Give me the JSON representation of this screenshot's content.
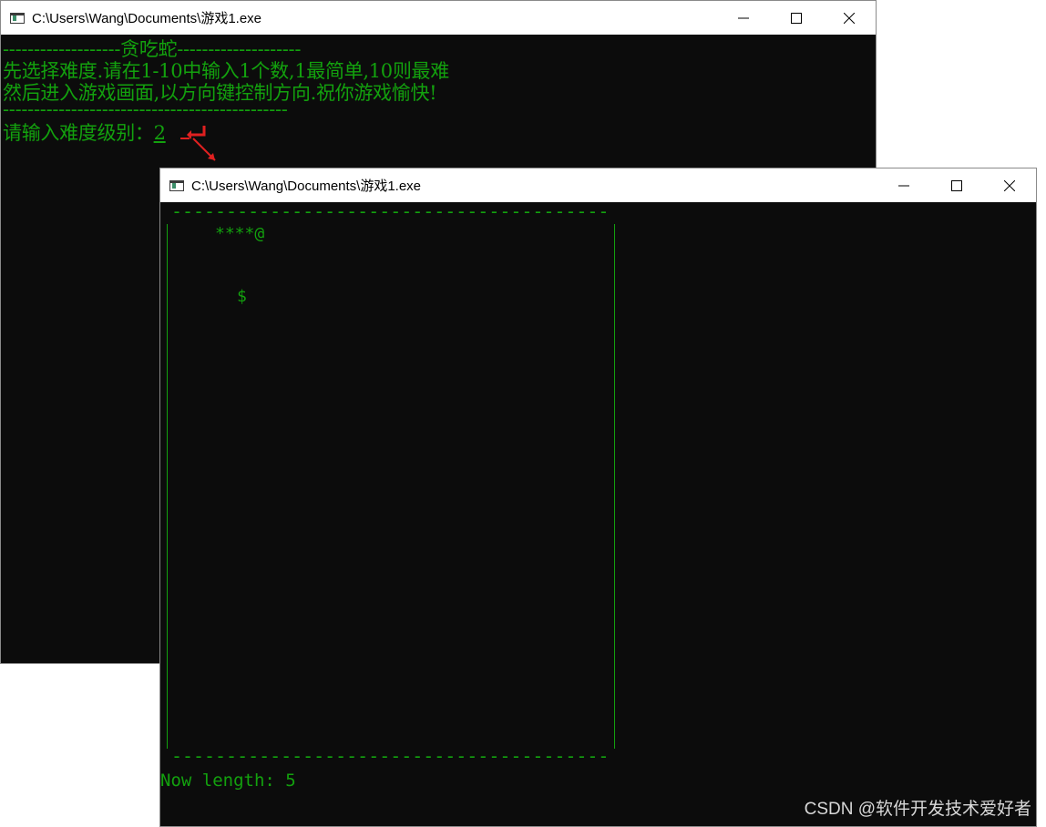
{
  "back_window": {
    "title": "C:\\Users\\Wang\\Documents\\游戏1.exe",
    "lines": [
      "-------------------贪吃蛇--------------------",
      "先选择难度.请在1-10中输入1个数,1最简单,10则最难",
      "然后进入游戏画面,以方向键控制方向.祝你游戏愉快!",
      "----------------------------------------------"
    ],
    "prompt": "请输入难度级别：",
    "input_value": "2"
  },
  "front_window": {
    "title": "C:\\Users\\Wang\\Documents\\游戏1.exe",
    "border_top": "----------------------------------------",
    "border_bottom": "----------------------------------------",
    "snake": "****@",
    "food": "$",
    "status": "Now length: 5"
  },
  "watermark": "CSDN @软件开发技术爱好者",
  "colors": {
    "console_bg": "#0c0c0c",
    "console_text": "#13a10e",
    "annotation": "#e02020"
  },
  "icons": {
    "app": "console-app-icon",
    "minimize": "minimize-icon",
    "maximize": "maximize-icon",
    "close": "close-icon"
  }
}
